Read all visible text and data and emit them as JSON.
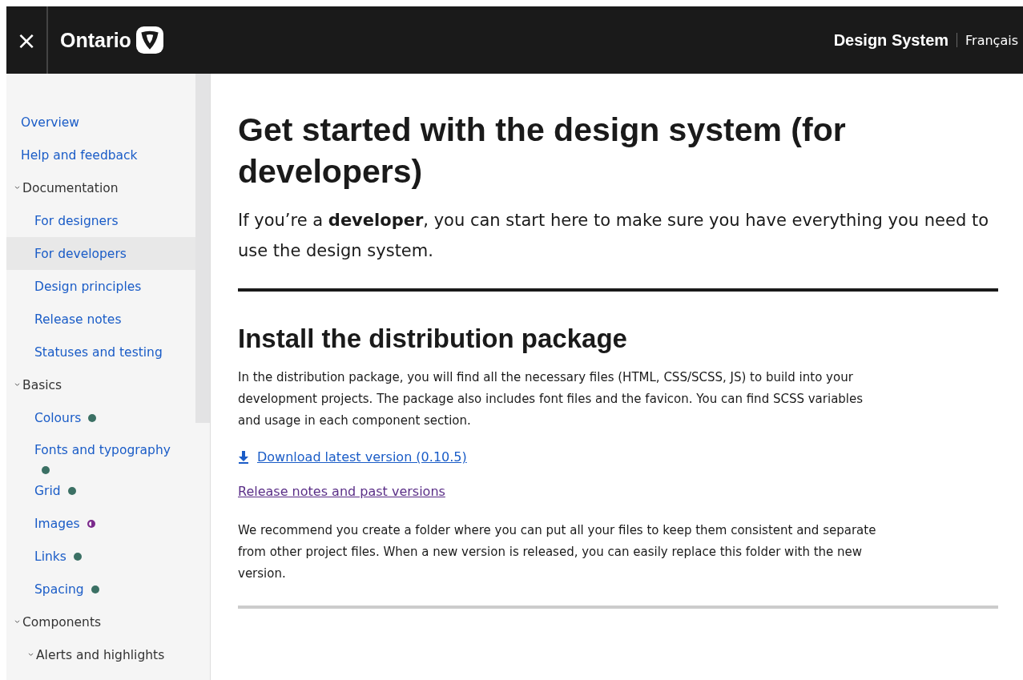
{
  "header": {
    "close_icon": "×",
    "logo": "Ontario",
    "site_title": "Design System",
    "language_link": "Français"
  },
  "sidebar": {
    "items": [
      {
        "label": "Overview",
        "selected": false
      },
      {
        "label": "Help and feedback",
        "selected": false
      },
      {
        "label": "Documentation",
        "expanded": true,
        "children": [
          {
            "label": "For designers",
            "selected": false
          },
          {
            "label": "For developers",
            "selected": true
          },
          {
            "label": "Design principles",
            "selected": false
          },
          {
            "label": "Release notes",
            "selected": false
          },
          {
            "label": "Statuses and testing",
            "selected": false
          }
        ]
      },
      {
        "label": "Basics",
        "expanded": true,
        "children": [
          {
            "label": "Colours",
            "selected": false,
            "kind": "full",
            "color": "#3b7064"
          },
          {
            "label": "Fonts and typography",
            "selected": false,
            "kind": "full",
            "color": "#3b7064"
          },
          {
            "label": "Grid",
            "selected": false,
            "kind": "full",
            "color": "#3b7064"
          },
          {
            "label": "Images",
            "selected": false,
            "kind": "half",
            "color": "#7b2a8c"
          },
          {
            "label": "Links",
            "selected": false,
            "kind": "full",
            "color": "#3b7064"
          },
          {
            "label": "Spacing",
            "selected": false,
            "kind": "full",
            "color": "#3b7064"
          }
        ]
      },
      {
        "label": "Components",
        "expanded": true,
        "children": [
          {
            "label": "Alerts and highlights",
            "expanded": true
          }
        ]
      }
    ]
  },
  "main": {
    "title": "Get started with the design system (for developers)",
    "lead": "If you’re a **developer**, you can start here to make sure you have everything you need to use the design system.",
    "section_title": "Install the distribution package",
    "intro": "In the distribution package, you will find all the necessary files (HTML, CSS/SCSS, JS) to build into your development projects. The package also includes font files and the favicon. You can find SCSS variables and usage in each component section.",
    "download_link": "Download latest version (0.10.5)",
    "release_link": "Release notes and past versions",
    "recommendation": "We recommend you create a folder where you can put all your files to keep them consistent and separate from other project files. When a new version is released, you can easily replace this folder with the new version."
  }
}
